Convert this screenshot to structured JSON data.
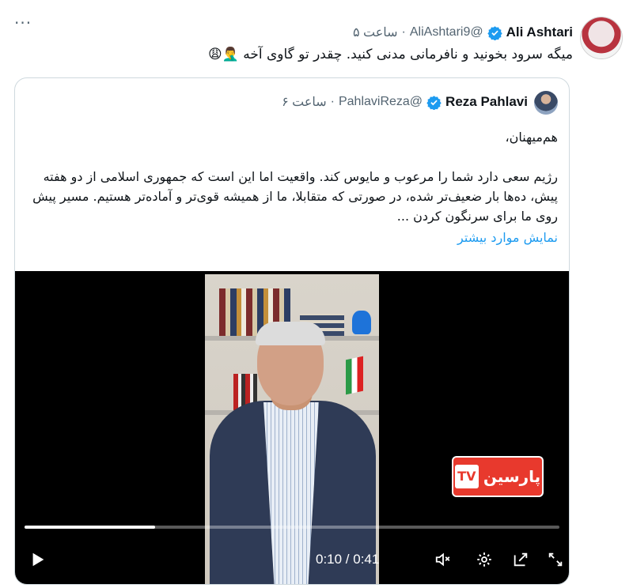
{
  "tweet": {
    "author_name": "Ali Ashtari",
    "handle": "@AliAshtari9",
    "separator": "·",
    "time": "ساعت ۵",
    "text": "میگه سرود بخونید و نافرمانی مدنی کنید. چقدر تو گاوی آخه",
    "emoji": "🤦‍♂️😩",
    "more_label": "···"
  },
  "quote": {
    "author_name": "Reza Pahlavi",
    "handle": "@PahlaviReza",
    "separator": "·",
    "time": "ساعت ۶",
    "greeting": "هم‌میهنان،",
    "body": "رژیم سعی دارد شما را مرعوب و مایوس کند. واقعیت اما این است که جمهوری اسلامی از دو هفته پیش، ده‌ها بار ضعیف‌تر شده، در صورتی که متقابلا، ما از همیشه قوی‌تر و آماده‌تر هستیم. مسیر پیش روی ما برای سرنگون کردن ...",
    "show_more": "نمایش موارد بیشتر"
  },
  "video": {
    "channel_logo": "پارسین",
    "channel_logo_mark": "TV",
    "time_readout": "0:10 / 0:41",
    "progress": 0.244
  },
  "colors": {
    "link": "#1d9bf0",
    "verified": "#1d9bf0",
    "muted": "#536471",
    "logo_red": "#e8392d"
  },
  "icons": [
    "more-icon",
    "verified-icon",
    "play-icon",
    "volume-icon",
    "settings-icon",
    "popout-icon",
    "fullscreen-icon"
  ]
}
